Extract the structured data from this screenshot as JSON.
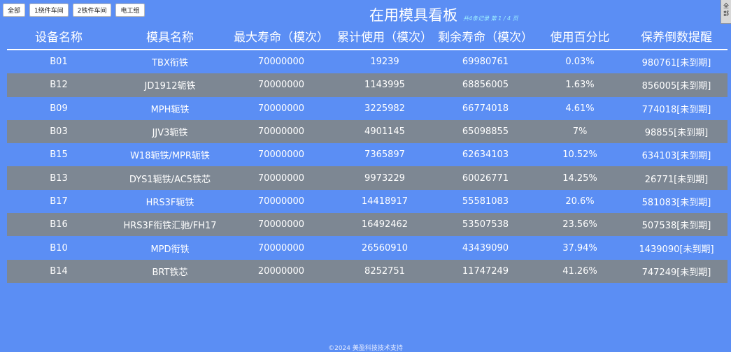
{
  "filters": [
    "全部",
    "1绕件车间",
    "2铁件车间",
    "电工组"
  ],
  "corner_button": "全部",
  "title": "在用模具看板",
  "subtitle": "共4条记录 第 1 / 4 页",
  "columns": [
    "设备名称",
    "模具名称",
    "最大寿命（模次）",
    "累计使用（模次）",
    "剩余寿命（模次）",
    "使用百分比",
    "保养倒数提醒"
  ],
  "rows": [
    [
      "B01",
      "TBX衔铁",
      "70000000",
      "19239",
      "69980761",
      "0.03%",
      "980761[未到期]"
    ],
    [
      "B12",
      "JD1912轭铁",
      "70000000",
      "1143995",
      "68856005",
      "1.63%",
      "856005[未到期]"
    ],
    [
      "B09",
      "MPH轭铁",
      "70000000",
      "3225982",
      "66774018",
      "4.61%",
      "774018[未到期]"
    ],
    [
      "B03",
      "JJV3轭铁",
      "70000000",
      "4901145",
      "65098855",
      "7%",
      "98855[未到期]"
    ],
    [
      "B15",
      "W18轭铁/MPR轭铁",
      "70000000",
      "7365897",
      "62634103",
      "10.52%",
      "634103[未到期]"
    ],
    [
      "B13",
      "DYS1轭铁/AC5铁芯",
      "70000000",
      "9973229",
      "60026771",
      "14.25%",
      "26771[未到期]"
    ],
    [
      "B17",
      "HRS3F轭铁",
      "70000000",
      "14418917",
      "55581083",
      "20.6%",
      "581083[未到期]"
    ],
    [
      "B16",
      "HRS3F衔铁汇驰/FH17",
      "70000000",
      "16492462",
      "53507538",
      "23.56%",
      "507538[未到期]"
    ],
    [
      "B10",
      "MPD衔铁",
      "70000000",
      "26560910",
      "43439090",
      "37.94%",
      "1439090[未到期]"
    ],
    [
      "B14",
      "BRT铁芯",
      "20000000",
      "8252751",
      "11747249",
      "41.26%",
      "747249[未到期]"
    ]
  ],
  "footer": "©2024 美盈科技技术支持",
  "colors": {
    "background": "#5b8ef4",
    "alt_row": "#7d8793",
    "subtitle": "#9ff1ff"
  }
}
